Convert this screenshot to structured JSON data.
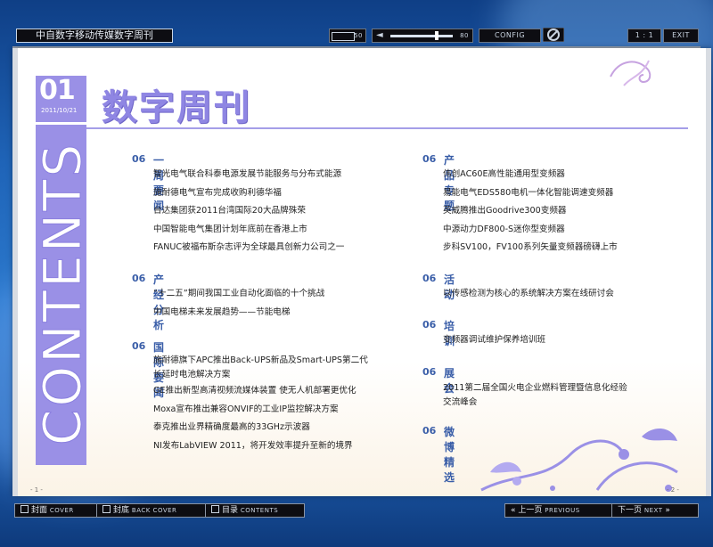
{
  "window": {
    "title": "中自数字移动传媒数字周刊"
  },
  "toolbar": {
    "page_num": "50",
    "volume_value": "80",
    "config_label": "CONFIG",
    "zoom_label": "1 : 1",
    "exit_label": "EXIT"
  },
  "header": {
    "issue_no": "01",
    "date": "2011/10/21",
    "title": "数字周刊",
    "side_label": "CONTENTS"
  },
  "sections_left": [
    {
      "num": "06",
      "title": "一周要闻",
      "items": [
        "智光电气联合科泰电源发展节能服务与分布式能源",
        "施耐德电气宣布完成收购利德华福",
        "台达集团获2011台湾国际20大品牌殊荣",
        "中国智能电气集团计划年底前在香港上市",
        "FANUC被福布斯杂志评为全球最具创新力公司之一"
      ]
    },
    {
      "num": "06",
      "title": "产经分析",
      "items": [
        "“十二五”期间我国工业自动化面临的十个挑战",
        "中国电梯未来发展趋势——节能电梯"
      ]
    },
    {
      "num": "06",
      "title": "国际要闻",
      "items": [
        "施耐德旗下APC推出Back-UPS新品及Smart-UPS第二代",
        "长延时电池解决方案",
        "GE推出新型高清视频流媒体装置 使无人机部署更优化",
        "Moxa宣布推出兼容ONVIF的工业IP监控解决方案",
        "泰克推出业界精确度最高的33GHz示波器",
        "NI发布LabVIEW 2011，将开发效率提升至新的境界"
      ]
    }
  ],
  "sections_right": [
    {
      "num": "06",
      "title": "产品专题",
      "items": [
        "伟创AC60E高性能通用型变频器",
        "易能电气EDS580电机一体化智能调速变频器",
        "英威腾推出Goodrive300变频器",
        "中源动力DF800-S迷你型变频器",
        "步科SV100，FV100系列矢量变频器磅礴上市"
      ]
    },
    {
      "num": "06",
      "title": "活动",
      "items": [
        "以传感检测为核心的系统解决方案在线研讨会"
      ]
    },
    {
      "num": "06",
      "title": "培训",
      "items": [
        "变频器调试维护保养培训班"
      ]
    },
    {
      "num": "06",
      "title": "展会",
      "items": [
        "2011第二届全国火电企业燃料管理暨信息化经验",
        "交流峰会"
      ]
    },
    {
      "num": "06",
      "title": "微博精选",
      "items": []
    }
  ],
  "pages": {
    "left": "- 1 -",
    "right": "- 2 -"
  },
  "bottom_nav": {
    "cover": {
      "cn": "封面",
      "en": "COVER"
    },
    "back_cover": {
      "cn": "封底",
      "en": "BACK COVER"
    },
    "toc": {
      "cn": "目录",
      "en": "CONTENTS"
    },
    "prev": {
      "cn": "上一页",
      "en": "PREVIOUS"
    },
    "next": {
      "cn": "下一页",
      "en": "NEXT"
    }
  },
  "colors": {
    "accent": "#9a90e6",
    "heading": "#3a5ea8",
    "background": "#1f64b8"
  }
}
